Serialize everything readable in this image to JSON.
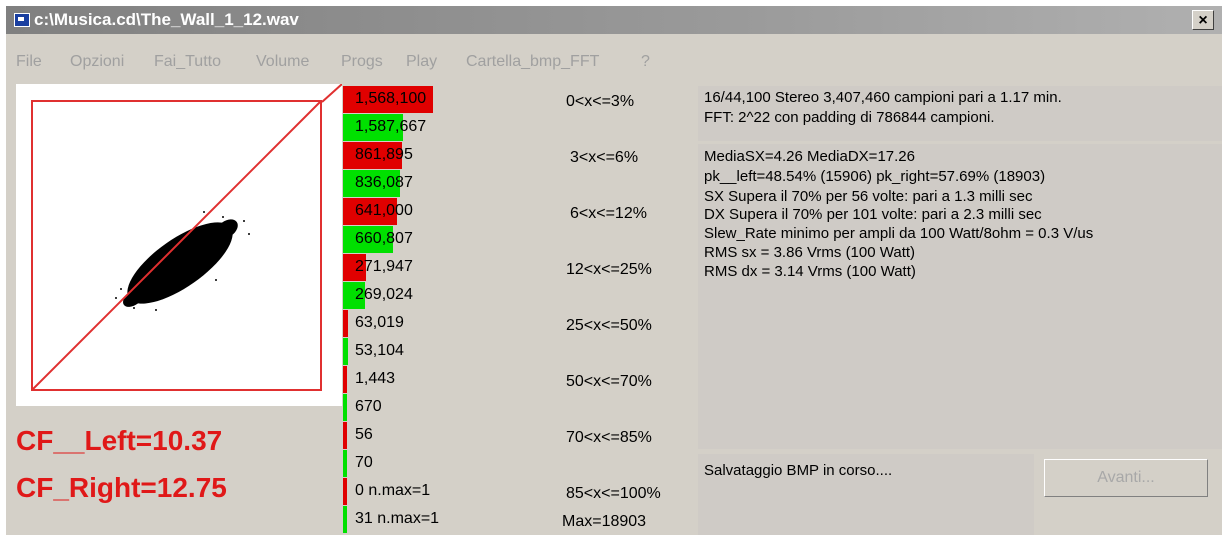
{
  "window": {
    "title": "c:\\Musica.cd\\The_Wall_1_12.wav",
    "close_label": "×"
  },
  "menu": [
    "File",
    "Opzioni",
    "Fai_Tutto",
    "Volume",
    "Progs",
    "Play",
    "Cartella_bmp_FFT",
    "?"
  ],
  "colors": {
    "bar_left": "#e00000",
    "bar_right": "#00e000",
    "plot_frame": "#e03030",
    "cf_text": "#e01818"
  },
  "cf": {
    "left": "CF__Left=10.37",
    "right": "CF_Right=12.75"
  },
  "histogram": {
    "rows": [
      {
        "count": "1,568,100",
        "channel": "left",
        "fill": 1.0
      },
      {
        "count": "1,587,667",
        "channel": "right",
        "fill": 0.67
      },
      {
        "count": "861,895",
        "channel": "left",
        "fill": 0.65
      },
      {
        "count": "836,087",
        "channel": "right",
        "fill": 0.63
      },
      {
        "count": "641,000",
        "channel": "left",
        "fill": 0.6
      },
      {
        "count": "660,807",
        "channel": "right",
        "fill": 0.55
      },
      {
        "count": "271,947",
        "channel": "left",
        "fill": 0.25
      },
      {
        "count": "269,024",
        "channel": "right",
        "fill": 0.24
      },
      {
        "count": "63,019",
        "channel": "left",
        "fill": 0.06
      },
      {
        "count": "53,104",
        "channel": "right",
        "fill": 0.05
      },
      {
        "count": "1,443",
        "channel": "left",
        "fill": 0.025
      },
      {
        "count": "670",
        "channel": "right",
        "fill": 0.025
      },
      {
        "count": "56",
        "channel": "left",
        "fill": 0.02
      },
      {
        "count": "70",
        "channel": "right",
        "fill": 0.02
      },
      {
        "count": "0 n.max=1",
        "channel": "left",
        "fill": 0.02
      },
      {
        "count": "31 n.max=1",
        "channel": "right",
        "fill": 0.02
      }
    ],
    "ranges": [
      "0<x<=3%",
      "3<x<=6%",
      "6<x<=12%",
      "12<x<=25%",
      "25<x<=50%",
      "50<x<=70%",
      "70<x<=85%",
      "85<x<=100%"
    ],
    "max_label": "Max=18903"
  },
  "info": {
    "format": "16/44,100 Stereo 3,407,460 campioni pari a 1.17 min.",
    "fft": "FFT: 2^22 con padding di 786844 campioni.",
    "stats": [
      "MediaSX=4.26  MediaDX=17.26",
      "pk__left=48.54% (15906)  pk_right=57.69% (18903)",
      "SX Supera il 70% per 56 volte: pari a 1.3 milli sec",
      "DX Supera il 70% per 101 volte: pari a 2.3 milli sec",
      "Slew_Rate minimo per ampli da 100 Watt/8ohm = 0.3 V/us",
      "RMS sx = 3.86 Vrms (100 Watt)",
      "RMS dx = 3.14 Vrms (100 Watt)"
    ],
    "status": "Salvataggio BMP in corso...."
  },
  "avanti_label": "Avanti..."
}
